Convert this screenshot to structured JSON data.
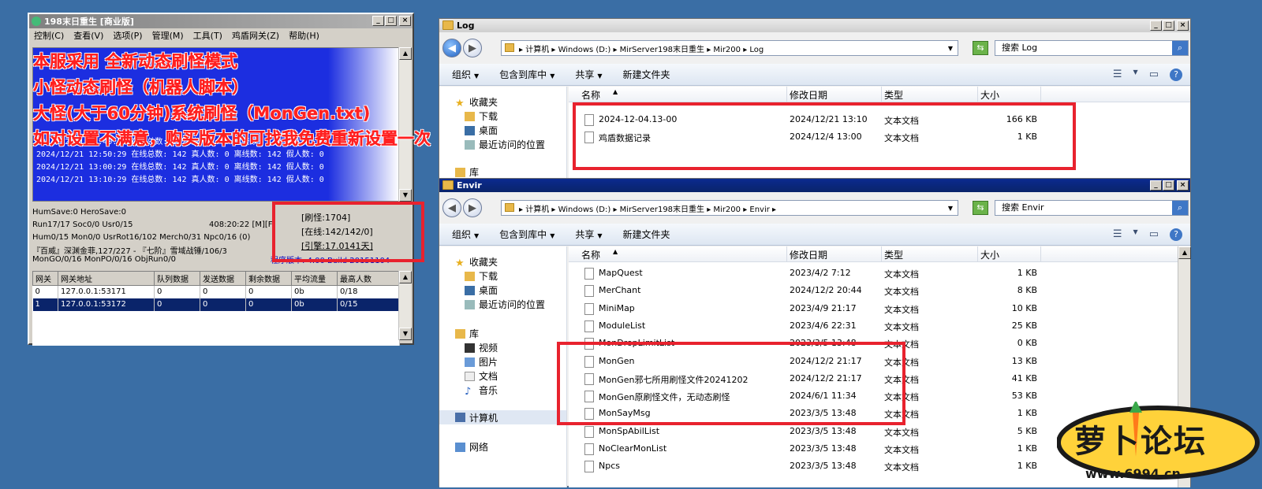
{
  "game_window": {
    "title": "198末日重生 [商业版]",
    "menu": [
      "控制(C)",
      "查看(V)",
      "选项(P)",
      "管理(M)",
      "工具(T)",
      "鸡盾网关(Z)",
      "帮助(H)"
    ],
    "log_lines": [
      "2024/12/21 12:40:29 在线总数: 142 真人数: 0 离线数: 142 假人数: 0",
      "2024/12/21 12:50:29 在线总数: 142 真人数: 0 离线数: 142 假人数: 0",
      "2024/12/21 13:00:29 在线总数: 142 真人数: 0 离线数: 142 假人数: 0",
      "2024/12/21 13:10:29 在线总数: 142 真人数: 0 离线数: 142 假人数: 0"
    ],
    "stats": [
      "HumSave:0 HeroSave:0",
      "Run17/17 Soc0/0 Usr0/15",
      "408:20:22 [M][F]",
      "Hum0/15 Mon0/0 UsrRot16/102 Merch0/31 Npc0/16 (0)",
      "『百威』深渊金菲,127/227 - 『七阶』雪域战锤/106/3",
      "MonGO/0/16 MonPO/0/16 ObjRun0/0"
    ],
    "side_stats": [
      "[刷怪:1704]",
      "[在线:142/142/0]",
      "[引擎:17.0141天]"
    ],
    "version_text": "程序版本: 4.00 Build 20151104",
    "table_headers": [
      "网关",
      "网关地址",
      "队列数据",
      "发送数据",
      "剩余数据",
      "平均流量",
      "最高人数"
    ],
    "table_rows": [
      [
        "0",
        "127.0.0.1:53171",
        "0",
        "0",
        "0",
        "0b",
        "0/18"
      ],
      [
        "1",
        "127.0.0.1:53172",
        "0",
        "0",
        "0",
        "0b",
        "0/15"
      ]
    ],
    "overlay_text": [
      "本服采用 全新动态刷怪模式",
      "小怪动态刷怪（机器人脚本）",
      "大怪(大于60分钟)系统刷怪（MonGen.txt)",
      "如对设置不满意，购买版本的可找我免费重新设置一次"
    ]
  },
  "log_window": {
    "title": "Log",
    "address": "▸ 计算机 ▸ Windows (D:) ▸ MirServer198末日重生 ▸ Mir200 ▸ Log",
    "search_placeholder": "搜索 Log",
    "toolbar": [
      "组织",
      "包含到库中",
      "共享",
      "新建文件夹"
    ],
    "nav": [
      "收藏夹",
      "下载",
      "桌面",
      "最近访问的位置",
      "库"
    ],
    "columns": [
      "名称",
      "修改日期",
      "类型",
      "大小"
    ],
    "files": [
      {
        "name": "2024-12-04.13-00",
        "date": "2024/12/21 13:10",
        "type": "文本文档",
        "size": "166 KB"
      },
      {
        "name": "鸡盾数据记录",
        "date": "2024/12/4 13:00",
        "type": "文本文档",
        "size": "1 KB"
      }
    ]
  },
  "envir_window": {
    "title": "Envir",
    "address": "▸ 计算机 ▸ Windows (D:) ▸ MirServer198末日重生 ▸ Mir200 ▸ Envir ▸",
    "search_placeholder": "搜索 Envir",
    "toolbar": [
      "组织",
      "包含到库中",
      "共享",
      "新建文件夹"
    ],
    "nav": [
      "收藏夹",
      "下载",
      "桌面",
      "最近访问的位置",
      "库",
      "视频",
      "图片",
      "文档",
      "音乐",
      "计算机",
      "网络"
    ],
    "columns": [
      "名称",
      "修改日期",
      "类型",
      "大小"
    ],
    "files": [
      {
        "name": "MapQuest",
        "date": "2023/4/2 7:12",
        "type": "文本文档",
        "size": "1 KB"
      },
      {
        "name": "MerChant",
        "date": "2024/12/2 20:44",
        "type": "文本文档",
        "size": "8 KB"
      },
      {
        "name": "MiniMap",
        "date": "2023/4/9 21:17",
        "type": "文本文档",
        "size": "10 KB"
      },
      {
        "name": "ModuleList",
        "date": "2023/4/6 22:31",
        "type": "文本文档",
        "size": "25 KB"
      },
      {
        "name": "MonDropLimitList",
        "date": "2023/3/5 13:48",
        "type": "文本文档",
        "size": "0 KB"
      },
      {
        "name": "MonGen",
        "date": "2024/12/2 21:17",
        "type": "文本文档",
        "size": "13 KB"
      },
      {
        "name": "MonGen邪七所用刷怪文件20241202",
        "date": "2024/12/2 21:17",
        "type": "文本文档",
        "size": "41 KB"
      },
      {
        "name": "MonGen原刷怪文件，无动态刷怪",
        "date": "2024/6/1 11:34",
        "type": "文本文档",
        "size": "53 KB"
      },
      {
        "name": "MonSayMsg",
        "date": "2023/3/5 13:48",
        "type": "文本文档",
        "size": "1 KB"
      },
      {
        "name": "MonSpAbilList",
        "date": "2023/3/5 13:48",
        "type": "文本文档",
        "size": "5 KB"
      },
      {
        "name": "NoClearMonList",
        "date": "2023/3/5 13:48",
        "type": "文本文档",
        "size": "1 KB"
      },
      {
        "name": "Npcs",
        "date": "2023/3/5 13:48",
        "type": "文本文档",
        "size": "1 KB"
      }
    ]
  },
  "watermark": {
    "brand": "萝卜论坛",
    "url": "www.6994.cn"
  },
  "colors": {
    "desktop": "#3a6ea5",
    "highlight": "#e8222e",
    "log_bg": "#1c2ee0",
    "selection": "#0a246a"
  }
}
